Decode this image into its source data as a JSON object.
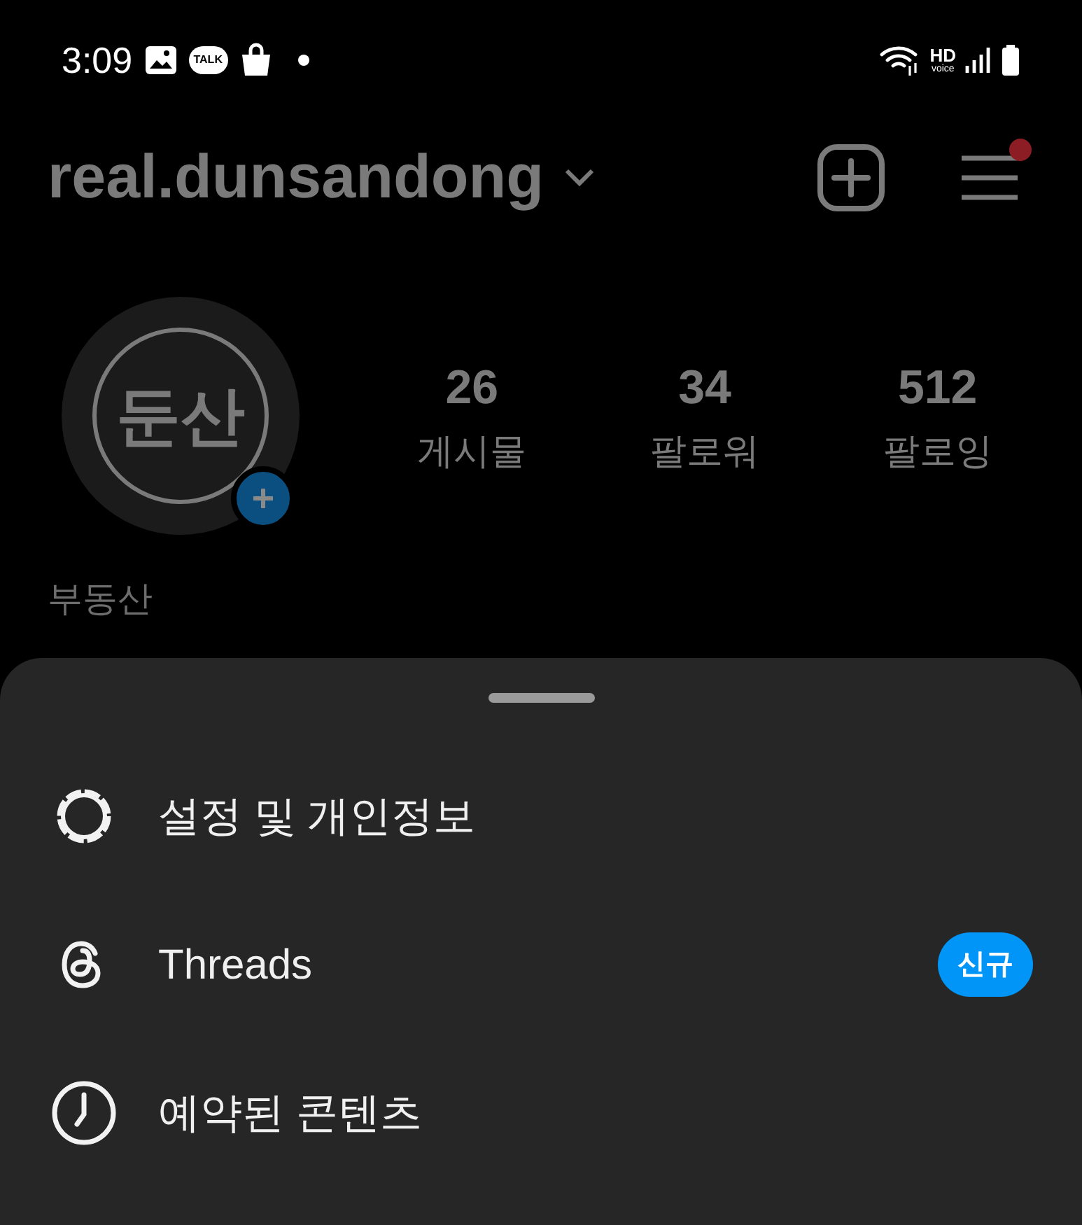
{
  "status_bar": {
    "time": "3:09",
    "chat_icon_label": "TALK",
    "hd_label": "HD",
    "voice_label": "voice"
  },
  "header": {
    "username": "real.dunsandong",
    "has_notification": true
  },
  "profile": {
    "avatar_text": "둔산",
    "stats": [
      {
        "value": "26",
        "label": "게시물"
      },
      {
        "value": "34",
        "label": "팔로워"
      },
      {
        "value": "512",
        "label": "팔로잉"
      }
    ],
    "name": "부동산"
  },
  "sheet": {
    "items": [
      {
        "label": "설정 및 개인정보"
      },
      {
        "label": "Threads",
        "badge": "신규"
      },
      {
        "label": "예약된 콘텐츠"
      }
    ]
  }
}
